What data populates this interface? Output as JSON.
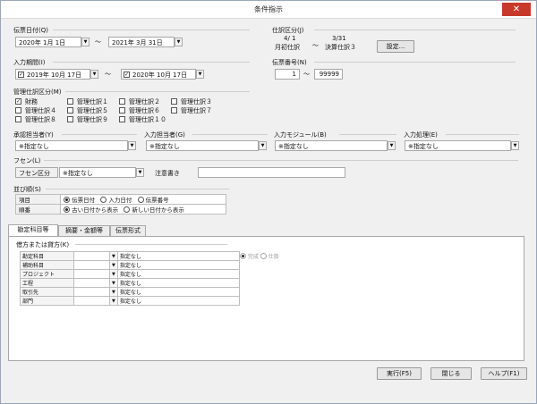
{
  "window": {
    "title": "条件指示",
    "close": "✕"
  },
  "denpyo_date": {
    "label": "伝票日付(Q)",
    "from": "2020年 1月 1日",
    "tilde": "～",
    "to": "2021年 3月 31日"
  },
  "shiwake_kubun": {
    "label": "仕訳区分(J)",
    "left_top": "4/ 1",
    "left_bottom": "月初仕訳",
    "tilde": "～",
    "right_top": "3/31",
    "right_bottom": "決算仕訳３",
    "settings_button": "設定..."
  },
  "input_period": {
    "label": "入力期間(I)",
    "from": "2019年 10月 17日",
    "tilde": "～",
    "to": "2020年 10月 17日"
  },
  "denpyo_number": {
    "label": "伝票番号(N)",
    "from": "1",
    "tilde": "～",
    "to": "99999"
  },
  "kanri_shiwake": {
    "label": "管理仕訳区分(M)",
    "items": [
      {
        "label": "財務",
        "checked": true
      },
      {
        "label": "管理仕訳１",
        "checked": false
      },
      {
        "label": "管理仕訳２",
        "checked": false
      },
      {
        "label": "管理仕訳３",
        "checked": false
      },
      {
        "label": "管理仕訳４",
        "checked": false
      },
      {
        "label": "管理仕訳５",
        "checked": false
      },
      {
        "label": "管理仕訳６",
        "checked": false
      },
      {
        "label": "管理仕訳７",
        "checked": false
      },
      {
        "label": "管理仕訳８",
        "checked": false
      },
      {
        "label": "管理仕訳９",
        "checked": false
      },
      {
        "label": "管理仕訳１０",
        "checked": false
      }
    ]
  },
  "approver": {
    "label": "承認担当者(Y)",
    "value": "※指定なし"
  },
  "input_staff": {
    "label": "入力担当者(G)",
    "value": "※指定なし"
  },
  "input_module": {
    "label": "入力モジュール(B)",
    "value": "※指定なし"
  },
  "input_process": {
    "label": "入力処理(E)",
    "value": "※指定なし"
  },
  "fusen": {
    "label": "フセン(L)",
    "kubun_label": "フセン区分",
    "kubun_value": "※指定なし",
    "note_label": "注意書き",
    "note_value": ""
  },
  "sort": {
    "label": "並び順(S)",
    "item_label": "項目",
    "item_options": [
      "伝票日付",
      "入力日付",
      "伝票番号"
    ],
    "order_label": "順番",
    "order_options": [
      "古い日付から表示",
      "新しい日付から表示"
    ]
  },
  "tabs": [
    "勘定科目等",
    "摘要・金額等",
    "伝票形式"
  ],
  "debit_credit_label": "借方または貸方(K)",
  "grid_rows": [
    {
      "label": "勘定科目",
      "value": "指定なし"
    },
    {
      "label": "補助科目",
      "value": "指定なし"
    },
    {
      "label": "プロジェクト",
      "value": "指定なし"
    },
    {
      "label": "工程",
      "value": "指定なし"
    },
    {
      "label": "取引先",
      "value": "指定なし"
    },
    {
      "label": "部門",
      "value": "指定なし"
    }
  ],
  "status_radios": [
    "完成",
    "仕掛"
  ],
  "buttons": {
    "run": "実行(F5)",
    "close": "閉じる",
    "help": "ヘルプ(F1)"
  }
}
